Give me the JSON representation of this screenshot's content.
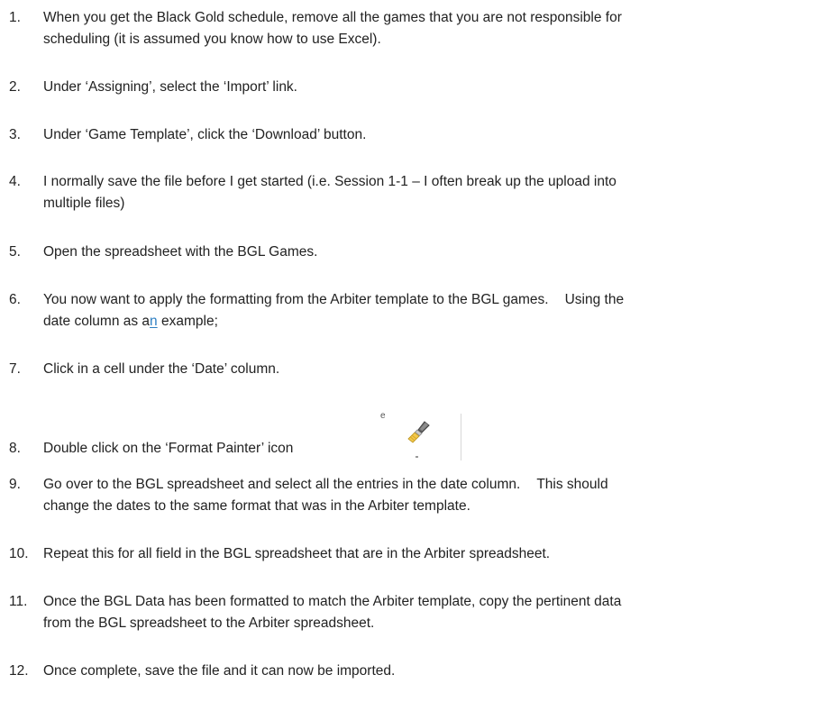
{
  "steps": [
    {
      "number": "1.",
      "lines": [
        "When you get the Black Gold schedule, remove all the games that you are not responsible for",
        "scheduling (it is assumed you know how to use Excel)."
      ]
    },
    {
      "number": "2.",
      "lines": [
        "Under ‘Assigning’, select the ‘Import’ link."
      ]
    },
    {
      "number": "3.",
      "lines": [
        "Under ‘Game Template’, click the ‘Download’ button."
      ]
    },
    {
      "number": "4.",
      "lines": [
        "I normally save the file before I get started (i.e. Session 1-1 – I often break up the upload into",
        "multiple files)"
      ]
    },
    {
      "number": "5.",
      "lines": [
        "Open the spreadsheet with the BGL Games."
      ]
    },
    {
      "number": "6.",
      "line1a": "You now want to apply the formatting from the Arbiter template to the BGL games.",
      "line1b": "Using the",
      "line2a": "date column as a",
      "line2link": "n",
      "line2b": " example;"
    },
    {
      "number": "7.",
      "lines": [
        "Click in a cell under the ‘Date’ column."
      ]
    },
    {
      "number": "8.",
      "lines": [
        "Double click on the ‘Format Painter’ icon"
      ],
      "icon_mark": "e"
    },
    {
      "number": "9.",
      "line1a": "Go over to the BGL spreadsheet and select all the entries in the date column.",
      "line1b": "This should",
      "line2": "change the dates to the same format that was in the Arbiter template."
    },
    {
      "number": "10.",
      "lines": [
        "Repeat this for all field in the BGL spreadsheet that are in the Arbiter spreadsheet."
      ]
    },
    {
      "number": "11.",
      "lines": [
        "Once the BGL Data has been formatted to match the Arbiter template, copy the pertinent data",
        "from the BGL spreadsheet to the Arbiter spreadsheet."
      ]
    },
    {
      "number": "12.",
      "lines": [
        "Once complete, save the file and it can now be imported."
      ]
    }
  ],
  "colors": {
    "text": "#222222",
    "link": "#2e7fc2"
  },
  "icons": {
    "format_painter": "format-painter-brush-icon"
  }
}
